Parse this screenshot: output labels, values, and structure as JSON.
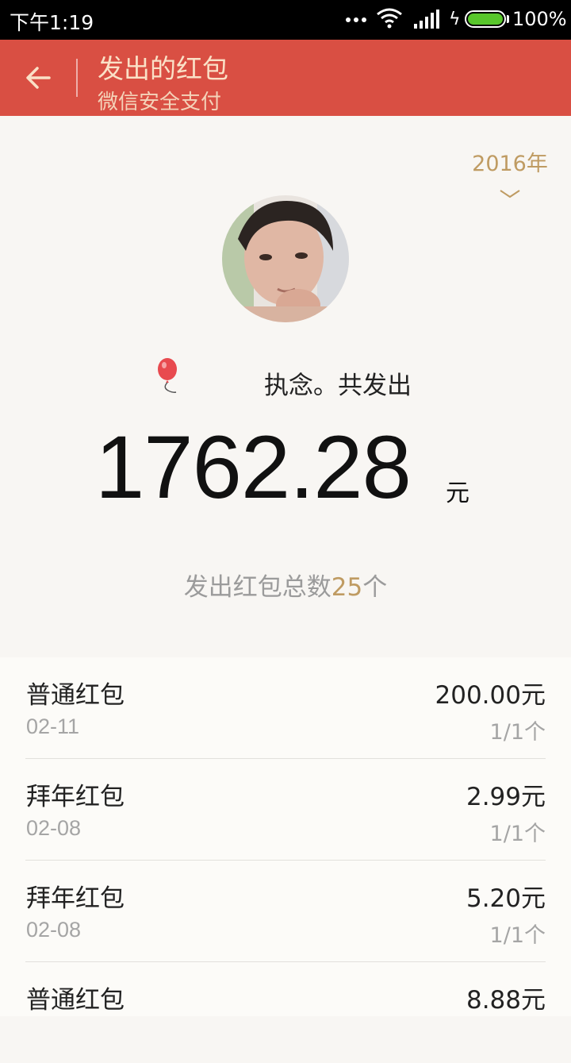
{
  "status_bar": {
    "time": "下午1:19",
    "battery": "100%"
  },
  "header": {
    "title": "发出的红包",
    "subtitle": "微信安全支付"
  },
  "year_selector": {
    "label": "2016年"
  },
  "summary": {
    "sender_text": "执念。共发出",
    "amount": "1762.28",
    "unit": "元",
    "count_prefix": "发出红包总数",
    "count": "25",
    "count_suffix": "个"
  },
  "packets": [
    {
      "type": "普通红包",
      "date": "02-11",
      "amount": "200.00元",
      "count": "1/1个"
    },
    {
      "type": "拜年红包",
      "date": "02-08",
      "amount": "2.99元",
      "count": "1/1个"
    },
    {
      "type": "拜年红包",
      "date": "02-08",
      "amount": "5.20元",
      "count": "1/1个"
    },
    {
      "type": "普通红包",
      "date": "",
      "amount": "8.88元",
      "count": ""
    }
  ],
  "colors": {
    "header_bg": "#d94f43",
    "accent_gold": "#bf9b62",
    "page_bg": "#f8f6f3"
  }
}
